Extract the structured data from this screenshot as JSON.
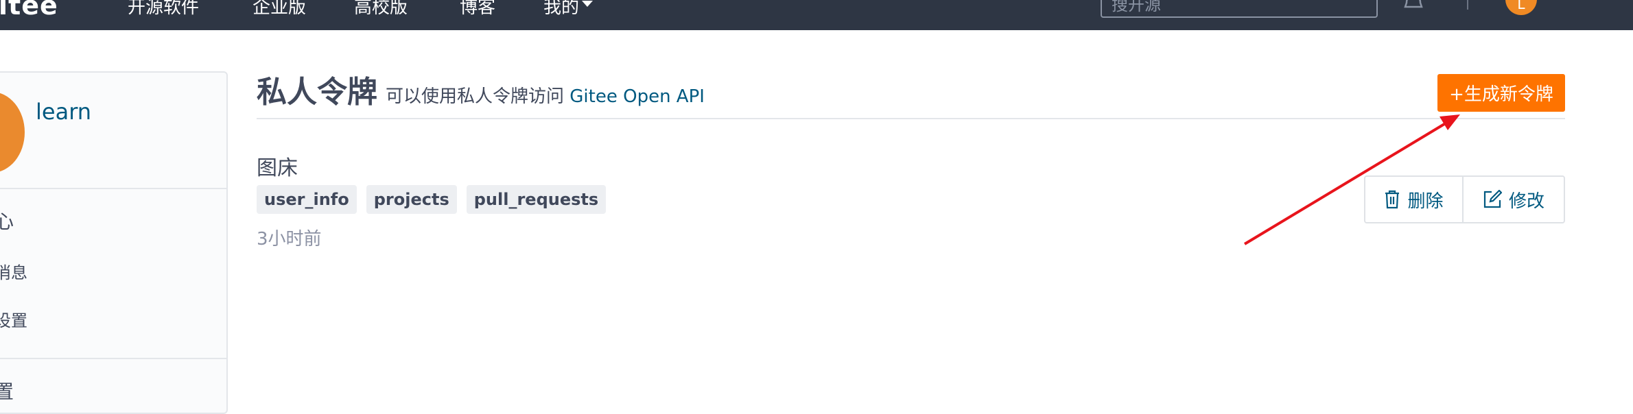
{
  "navbar": {
    "brand": "itee",
    "items": [
      {
        "label": "开源软件"
      },
      {
        "label": "企业版"
      },
      {
        "label": "高校版"
      },
      {
        "label": "博客"
      },
      {
        "label": "我的"
      }
    ],
    "search_placeholder": "搜开源",
    "avatar_letter": "L"
  },
  "sidebar": {
    "username": "learn",
    "items": [
      {
        "label": "心"
      },
      {
        "label": "消息"
      },
      {
        "label": "设置"
      },
      {
        "label": "置"
      }
    ]
  },
  "main": {
    "title": "私人令牌",
    "description": "可以使用私人令牌访问",
    "api_link": "Gitee Open API",
    "new_token_button": "生成新令牌",
    "token": {
      "name": "图床",
      "scopes": [
        "user_info",
        "projects",
        "pull_requests"
      ],
      "time": "3小时前",
      "delete_label": "删除",
      "edit_label": "修改"
    }
  },
  "colors": {
    "navbar_bg": "#2e3644",
    "accent_orange": "#fe7300",
    "link_blue": "#005980",
    "arrow_red": "#e8141c"
  }
}
